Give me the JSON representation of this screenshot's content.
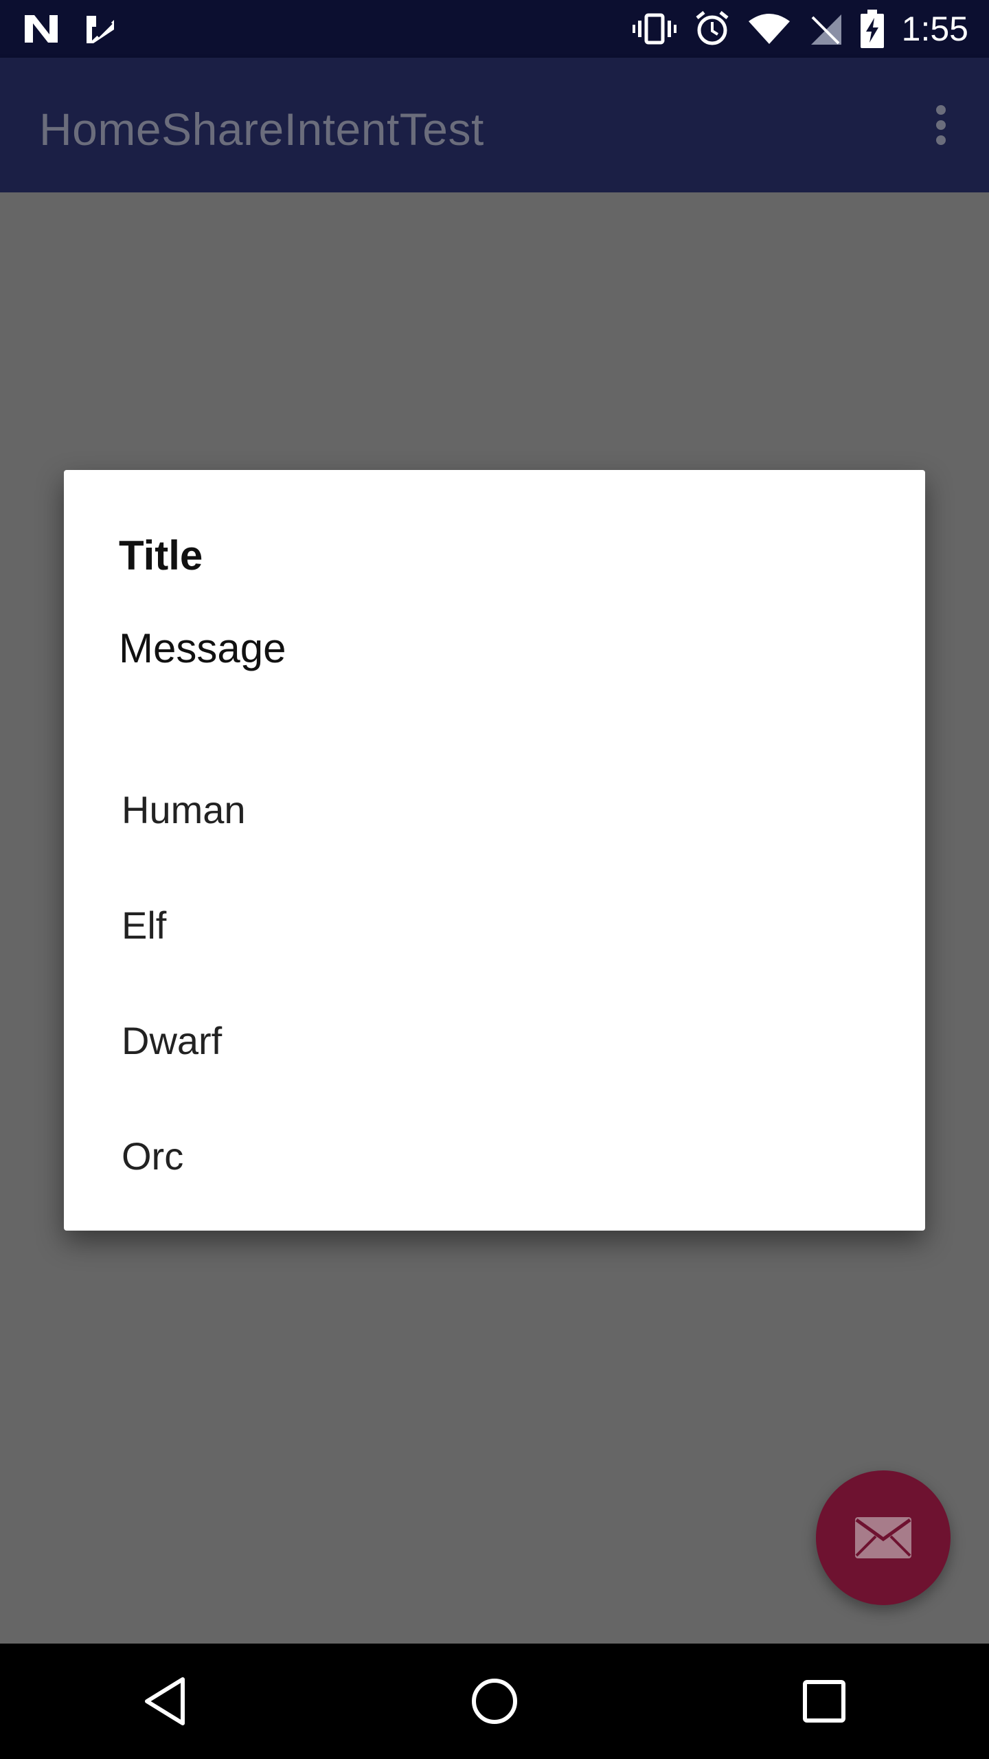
{
  "status_bar": {
    "time": "1:55",
    "left_icons": [
      "n-notification-icon",
      "check-notification-icon"
    ],
    "right_icons": [
      "vibrate-icon",
      "alarm-icon",
      "wifi-icon",
      "no-sim-icon",
      "battery-charging-icon"
    ]
  },
  "app_bar": {
    "title": "HomeShareIntentTest",
    "overflow_icon": "more-vert-icon"
  },
  "dialog": {
    "title": "Title",
    "message": "Message",
    "items": [
      "Human",
      "Elf",
      "Dwarf",
      "Orc"
    ]
  },
  "fab": {
    "icon": "email-icon",
    "color": "#6e1230"
  },
  "nav_bar": {
    "icons": [
      "back-icon",
      "home-icon",
      "recents-icon"
    ]
  },
  "colors": {
    "status_bar": "#0c0f30",
    "app_bar": "#1b1f45",
    "scrim": "#666666"
  }
}
